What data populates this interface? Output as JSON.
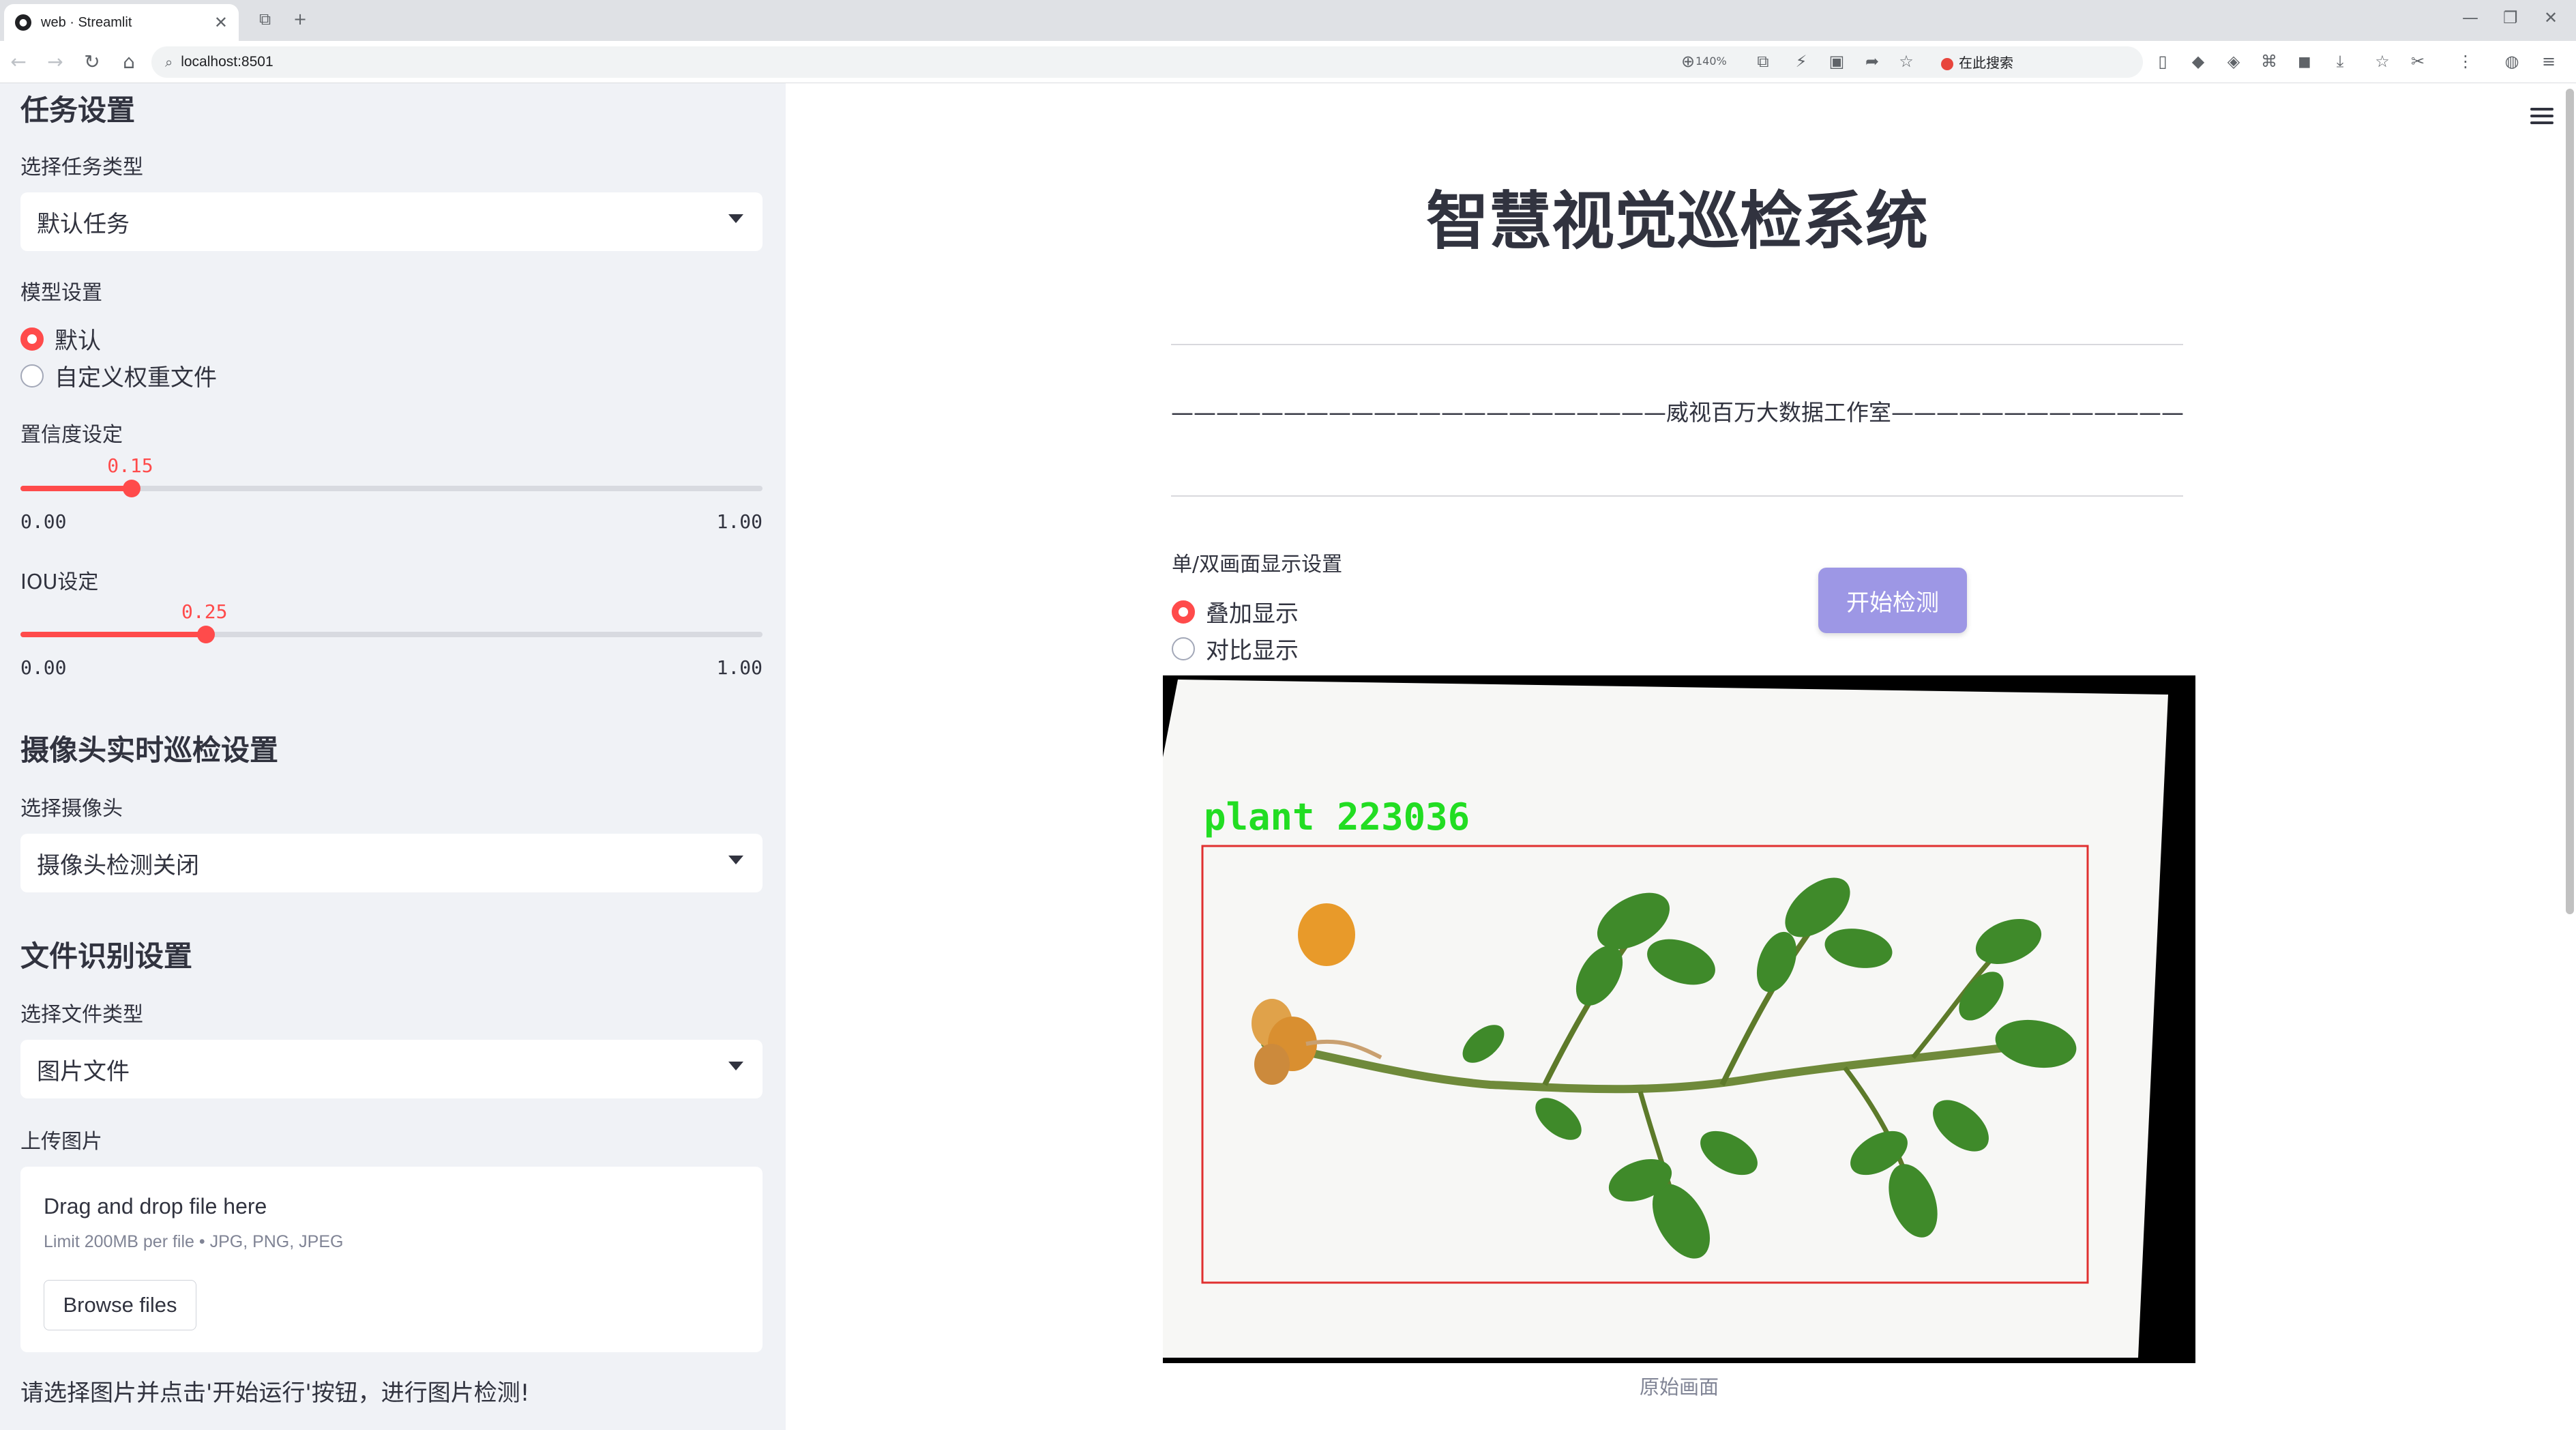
{
  "browser": {
    "tab_title": "web · Streamlit",
    "url": "localhost:8501",
    "zoom": "140%",
    "search_ext_label": "在此搜索"
  },
  "sidebar": {
    "task_heading": "任务设置",
    "task_type_label": "选择任务类型",
    "task_type_value": "默认任务",
    "model_label": "模型设置",
    "model_options": [
      {
        "label": "默认",
        "selected": true
      },
      {
        "label": "自定义权重文件",
        "selected": false
      }
    ],
    "confidence": {
      "label": "置信度设定",
      "value": 0.15,
      "display": "0.15",
      "min": "0.00",
      "max": "1.00"
    },
    "iou": {
      "label": "IOU设定",
      "value": 0.25,
      "display": "0.25",
      "min": "0.00",
      "max": "1.00"
    },
    "camera_heading": "摄像头实时巡检设置",
    "camera_label": "选择摄像头",
    "camera_value": "摄像头检测关闭",
    "file_heading": "文件识别设置",
    "file_type_label": "选择文件类型",
    "file_type_value": "图片文件",
    "upload_label": "上传图片",
    "uploader_main": "Drag and drop file here",
    "uploader_sub": "Limit 200MB per file • JPG, PNG, JPEG",
    "browse_label": "Browse files",
    "note": "请选择图片并点击'开始运行'按钮，进行图片检测!"
  },
  "main": {
    "title": "智慧视觉巡检系统",
    "subtitle": "——————————————————————威视百万大数据工作室———————————————————————",
    "display_label": "单/双画面显示设置",
    "display_options": [
      {
        "label": "叠加显示",
        "selected": true
      },
      {
        "label": "对比显示",
        "selected": false
      }
    ],
    "start_button": "开始检测",
    "detection_label": "plant  223036",
    "caption": "原始画面"
  },
  "colors": {
    "accent": "#ff4b4b",
    "button": "#9d97e5",
    "detection_box": "#e03030",
    "detection_text": "#22dd22"
  }
}
